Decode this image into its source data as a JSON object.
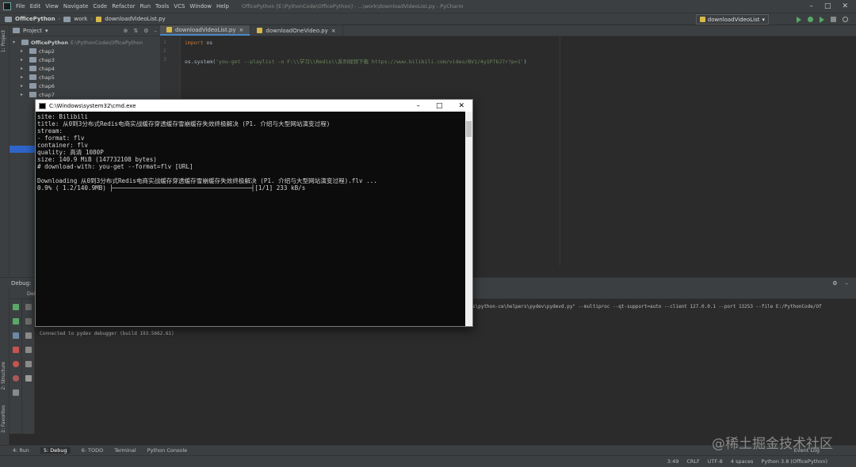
{
  "menubar": {
    "items": [
      "File",
      "Edit",
      "View",
      "Navigate",
      "Code",
      "Refactor",
      "Run",
      "Tools",
      "VCS",
      "Window",
      "Help"
    ],
    "title": "OfficePython [E:\\PythonCode\\OfficePython] - ...\\work\\downloadVideoList.py - PyCharm"
  },
  "navbar": {
    "project": "OfficePython",
    "folder": "work",
    "file": "downloadVideoList.py",
    "run_config": "downloadVideoList"
  },
  "project_panel": {
    "title": "Project",
    "tree": [
      {
        "label": "OfficePython",
        "path": "E:\\PythonCode\\OfficePython"
      },
      {
        "label": "chap2"
      },
      {
        "label": "chap3"
      },
      {
        "label": "chap4"
      },
      {
        "label": "chap5"
      },
      {
        "label": "chap6"
      },
      {
        "label": "chap7"
      }
    ]
  },
  "left_strip": {
    "project_tab": "1: Project",
    "structure_tab": "2: Structure",
    "favorites_tab": "2: Favorites"
  },
  "editor": {
    "tabs": [
      "downloadVideoList.py",
      "downloadOneVideo.py"
    ],
    "line_numbers": [
      "1",
      "2",
      "3"
    ],
    "code": {
      "l1_kw": "import",
      "l1_id": " os",
      "l3_id": "os.system(",
      "l3_str": "'you-get --playlist -o F:\\\\学习\\\\Redis\\\\系列视频下载 https://www.bilibili.com/video/BV1/4y1P7bJ7r?p=1'",
      "l3_end": ")"
    }
  },
  "debug": {
    "title": "Debug:",
    "tab_label": "Deb",
    "command_tail": "s\\python-ce\\helpers\\pydev\\pydevd.py\" --multiproc --qt-support=auto --client 127.0.0.1 --port 13253 --file E:/PythonCode/Of",
    "connected": "Connected to pydev debugger (build 193.5662.61)"
  },
  "bottom_tabs": [
    "4: Run",
    "5: Debug",
    "6: TODO",
    "Terminal",
    "Python Console"
  ],
  "statusbar": {
    "position": "3:49",
    "line_sep": "CRLF",
    "encoding": "UTF-8",
    "indent": "4 spaces",
    "interpreter": "Python 3.8 (OfficePython)",
    "event_log": "Event Log"
  },
  "cmd": {
    "title": "C:\\Windows\\system32\\cmd.exe",
    "lines": [
      "site:                Bilibili",
      "title:               从0到3分布式Redis电商实战缓存穿透缓存雪崩缓存失效终极解决 (P1. 介绍与大型网站演变过程)",
      "stream:",
      "    - format:        flv",
      "      container:     flv",
      "      quality:       高清 1080P",
      "      size:          140.9 MiB (147732108 bytes)",
      "    # download-with: you-get --format=flv [URL]",
      "",
      "Downloading 从0到3分布式Redis电商实战缓存穿透缓存雪崩缓存失效终极解决 (P1. 介绍与大型网站演变过程).flv ...",
      " 0.9% (  1.2/140.9MB) ├──────────────────────────────────────┤[1/1]  233 kB/s"
    ]
  },
  "watermark": "@稀土掘金技术社区",
  "colors": {
    "keyword": "#cc7832",
    "string": "#6a8759",
    "accent": "#4a88c7"
  }
}
